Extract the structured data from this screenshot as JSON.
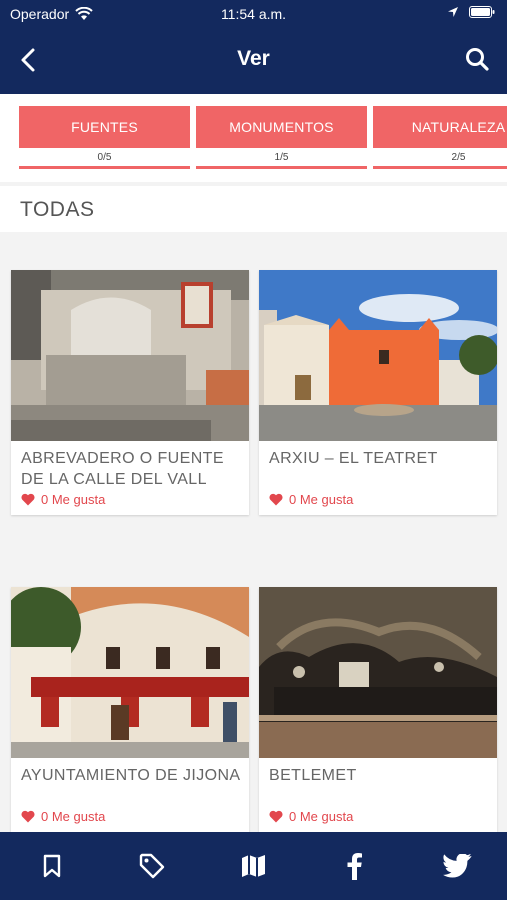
{
  "status_bar": {
    "carrier": "Operador",
    "time": "11:54 a.m."
  },
  "nav": {
    "title": "Ver",
    "back_icon": "chevron-left-icon",
    "search_icon": "search-icon"
  },
  "filters": [
    {
      "label": "FUENTES",
      "count": "0/5"
    },
    {
      "label": "MONUMENTOS",
      "count": "1/5"
    },
    {
      "label": "NATURALEZA",
      "count": "2/5"
    }
  ],
  "section": {
    "title": "TODAS"
  },
  "places": [
    {
      "name": "ABREVADERO O FUENTE DE LA CALLE DEL VALL",
      "likes": "0 Me gusta"
    },
    {
      "name": "ARXIU – EL TEATRET",
      "likes": "0 Me gusta"
    },
    {
      "name": "AYUNTAMIENTO DE JIJONA",
      "likes": "0 Me gusta"
    },
    {
      "name": "BETLEMET",
      "likes": "0 Me gusta"
    }
  ],
  "tab_bar": [
    "bookmark-icon",
    "tag-icon",
    "map-icon",
    "facebook-icon",
    "twitter-icon"
  ],
  "colors": {
    "primary": "#13295e",
    "accent": "#f06566",
    "like": "#e2474d"
  }
}
